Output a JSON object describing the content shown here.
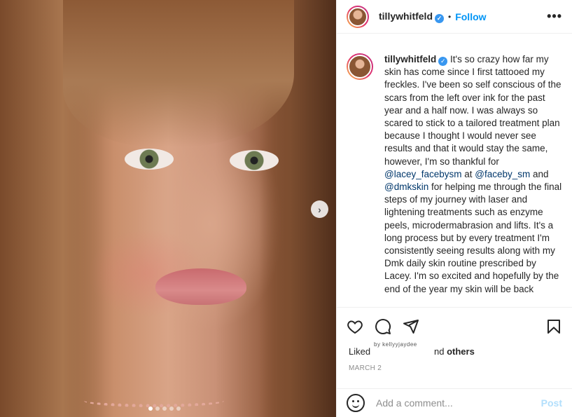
{
  "post": {
    "username": "tillywhitfeld",
    "verified": true,
    "separator": "•",
    "follow_label": "Follow",
    "more_icon": "more-horizontal-icon",
    "caption_parts": [
      {
        "type": "text",
        "value": " It's so crazy how far my skin has come since I first tattooed my freckles. I've been so self conscious of the scars from the left over ink for the past year and a half now. I was always so scared to stick to a tailored treatment plan because I thought I would never see results and that it would stay the same, however, I'm so thankful for "
      },
      {
        "type": "mention",
        "value": "@lacey_facebysm"
      },
      {
        "type": "text",
        "value": " at "
      },
      {
        "type": "mention",
        "value": "@faceby_sm"
      },
      {
        "type": "text",
        "value": " and "
      },
      {
        "type": "mention",
        "value": "@dmkskin"
      },
      {
        "type": "text",
        "value": " for helping me through the final steps of my journey with laser and lightening treatments such as enzyme peels, microdermabrasion and lifts. It's a long process but by every treatment I'm consistently seeing results along with my Dmk daily skin routine prescribed by Lacey. I'm so excited and hopefully by the end of the year my skin will be back"
      }
    ],
    "liked_prefix": "Liked",
    "liked_by_overlay": "by kellyyjaydee",
    "liked_suffix_text": "nd ",
    "liked_others": "others",
    "date": "MARCH 2",
    "comment_placeholder": "Add a comment...",
    "post_label": "Post",
    "carousel": {
      "slides": 5,
      "active": 1
    }
  },
  "colors": {
    "link": "#0095f6",
    "mention": "#00376b",
    "post_disabled": "#b2dffc",
    "verified": "#3897f0"
  }
}
